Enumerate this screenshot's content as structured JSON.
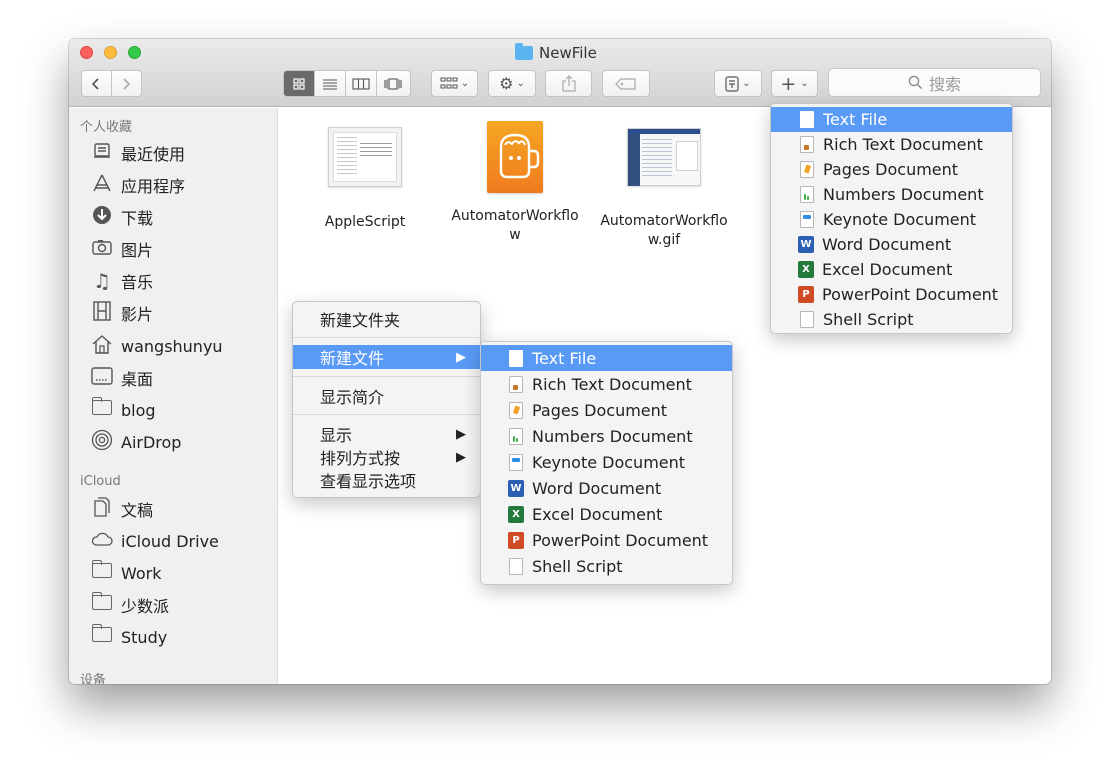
{
  "window": {
    "title": "NewFile",
    "search_placeholder": "搜索"
  },
  "toolbar": {
    "back_icon": "chevron-left-icon",
    "forward_icon": "chevron-right-icon",
    "view_modes": [
      "icon-view",
      "list-view",
      "column-view",
      "coverflow-view"
    ],
    "active_view": "icon-view"
  },
  "sidebar": {
    "sections": [
      {
        "title": "个人收藏",
        "items": [
          {
            "label": "最近使用",
            "icon": "recents-icon"
          },
          {
            "label": "应用程序",
            "icon": "applications-icon"
          },
          {
            "label": "下载",
            "icon": "downloads-icon"
          },
          {
            "label": "图片",
            "icon": "camera-icon"
          },
          {
            "label": "音乐",
            "icon": "music-icon"
          },
          {
            "label": "影片",
            "icon": "film-icon"
          },
          {
            "label": "wangshunyu",
            "icon": "home-icon"
          },
          {
            "label": "桌面",
            "icon": "desktop-icon"
          },
          {
            "label": "blog",
            "icon": "folder-icon"
          },
          {
            "label": "AirDrop",
            "icon": "airdrop-icon"
          }
        ]
      },
      {
        "title": "iCloud",
        "items": [
          {
            "label": "文稿",
            "icon": "documents-icon"
          },
          {
            "label": "iCloud Drive",
            "icon": "cloud-icon"
          },
          {
            "label": "Work",
            "icon": "folder-icon"
          },
          {
            "label": "少数派",
            "icon": "folder-icon"
          },
          {
            "label": "Study",
            "icon": "folder-icon"
          }
        ]
      },
      {
        "title": "设备",
        "items": []
      }
    ]
  },
  "files": [
    {
      "name": "AppleScript"
    },
    {
      "name": "AutomatorWorkflo\nw"
    },
    {
      "name": "AutomatorWorkflo\nw.gif"
    }
  ],
  "context_menu": {
    "items": [
      {
        "label": "新建文件夹"
      },
      {
        "label": "新建文件",
        "submenu": true,
        "selected": true
      },
      {
        "label": "显示简介"
      },
      {
        "label": "显示",
        "submenu": true
      },
      {
        "label": "排列方式按",
        "submenu": true
      },
      {
        "label": "查看显示选项"
      }
    ]
  },
  "new_file_types": [
    {
      "label": "Text File",
      "icon": "text-file-icon",
      "selected": true
    },
    {
      "label": "Rich Text Document",
      "icon": "rtf-icon"
    },
    {
      "label": "Pages Document",
      "icon": "pages-icon"
    },
    {
      "label": "Numbers Document",
      "icon": "numbers-icon"
    },
    {
      "label": "Keynote Document",
      "icon": "keynote-icon"
    },
    {
      "label": "Word Document",
      "icon": "word-icon"
    },
    {
      "label": "Excel Document",
      "icon": "excel-icon"
    },
    {
      "label": "PowerPoint Document",
      "icon": "powerpoint-icon"
    },
    {
      "label": "Shell Script",
      "icon": "shell-script-icon"
    }
  ],
  "colors": {
    "selection": "#5a9af7",
    "close": "#fc605c",
    "minimize": "#fdbc40",
    "maximize": "#34c84a",
    "folder": "#59b4f0"
  }
}
